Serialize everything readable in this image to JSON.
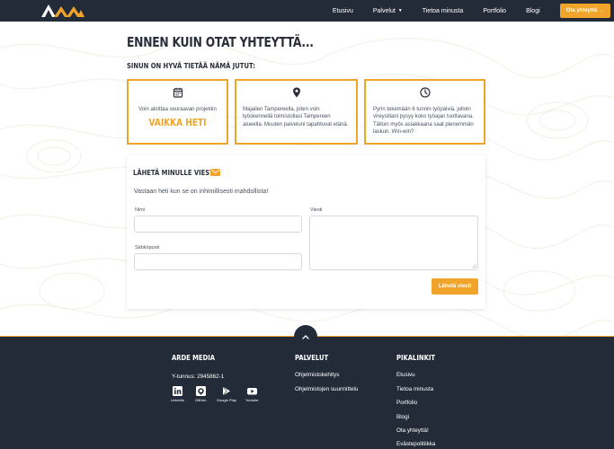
{
  "nav": {
    "logo_alt": "AM",
    "items": [
      {
        "label": "Etusivu"
      },
      {
        "label": "Palvelut",
        "dropdown": true
      },
      {
        "label": "Tietoa minusta"
      },
      {
        "label": "Portfolio"
      },
      {
        "label": "Blogi"
      }
    ],
    "cta": "Ota yhteyttä →"
  },
  "main": {
    "title": "ENNEN KUIN OTAT YHTEYTTÄ...",
    "subtitle": "SINUN ON HYVÄ TIETÄÄ NÄMÄ JUTUT:",
    "cards": [
      {
        "icon": "calendar-icon",
        "text": "Voin aloittaa seuraavan projektin",
        "highlight": "VAIKKA HETI"
      },
      {
        "icon": "map-pin-icon",
        "text": "Majailen Tampereella, joten voin työskennellä toimistollasi Tampereen alueella. Muuten palveluni tapahtuvat etänä."
      },
      {
        "icon": "clock-icon",
        "text": "Pyrin tekemään 6 tunnin työpäiviä, jolloin vireystilani pysyy koko työajan tuottavana. Tälloin myös asiakkaana saat pienemmän laskun. Win-win?"
      }
    ]
  },
  "form": {
    "title": "LÄHETÄ MINULLE VIESTI",
    "subtitle": "Vastaan heti kun se on inhimillisesti mahdollista!",
    "name_label": "Nimi",
    "email_label": "Sähköposti",
    "message_label": "Viesti",
    "name_value": "",
    "email_value": "",
    "message_value": "",
    "submit": "Lähetä viesti"
  },
  "footer": {
    "company": {
      "heading": "ARDE MEDIA",
      "business_id": "Y-tunnus: 2945862-1",
      "social": [
        {
          "icon": "linkedin-icon",
          "label": "LinkedIn"
        },
        {
          "icon": "github-icon",
          "label": "GitHub"
        },
        {
          "icon": "google-play-icon",
          "label": "Google Play"
        },
        {
          "icon": "youtube-icon",
          "label": "Youtube"
        }
      ]
    },
    "services": {
      "heading": "PALVELUT",
      "items": [
        "Ohjelmistokehitys",
        "Ohjelmistojen suunnittelu"
      ]
    },
    "quicklinks": {
      "heading": "PIKALINKIT",
      "items": [
        "Etusivu",
        "Tietoa minusta",
        "Portfolio",
        "Blogi",
        "Ota yhteyttä!",
        "Evästepolitiikka"
      ]
    }
  },
  "colors": {
    "accent": "#f0a42a",
    "dark": "#242b38"
  }
}
